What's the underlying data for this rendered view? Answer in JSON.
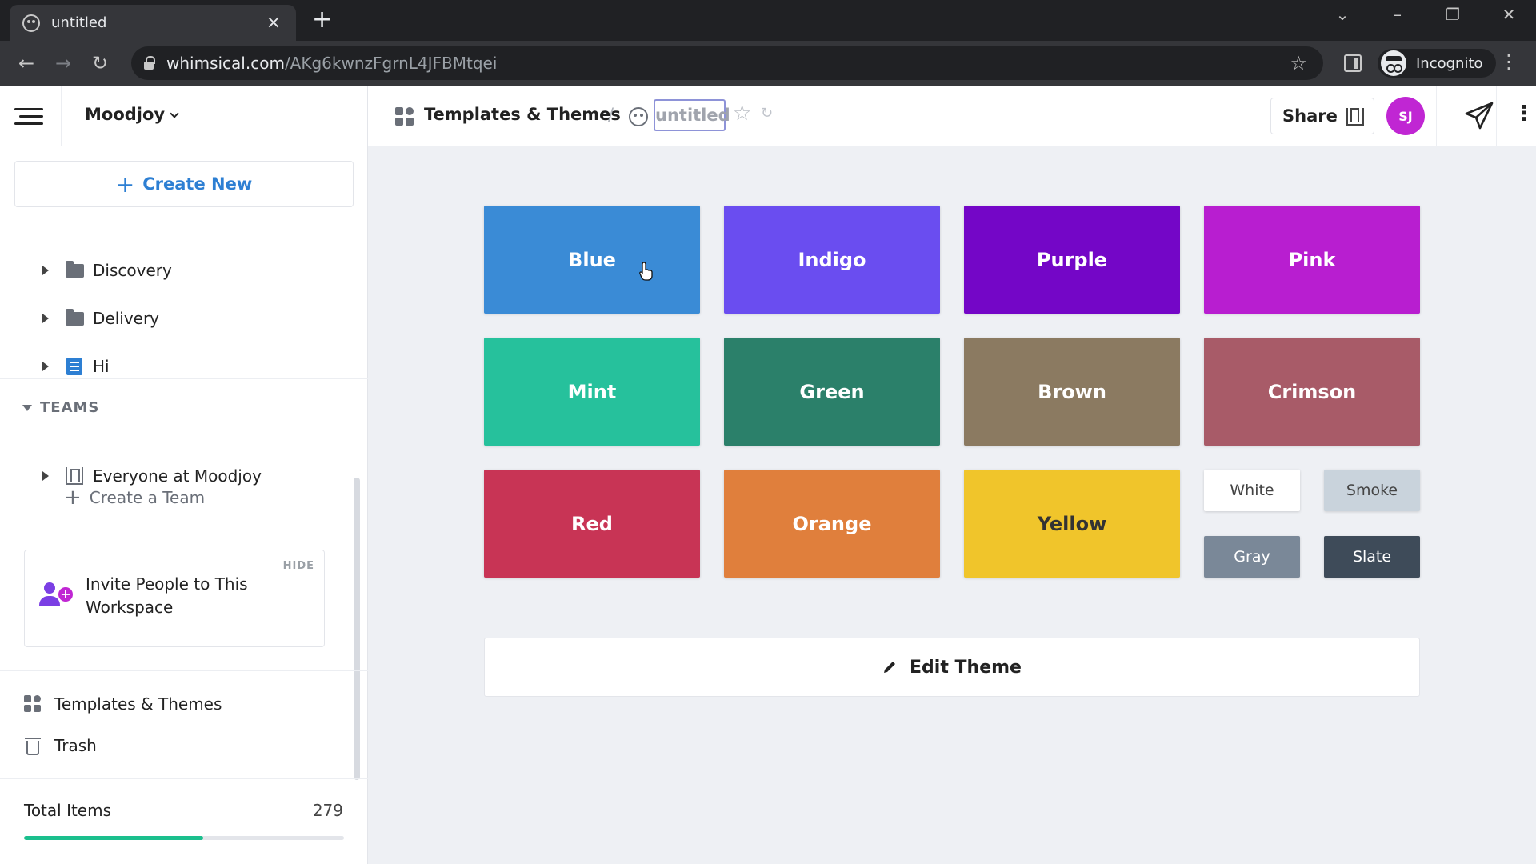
{
  "browser": {
    "tab_title": "untitled",
    "url_domain": "whimsical.com",
    "url_path": "/AKg6kwnzFgrnL4JFBMtqei",
    "profile_label": "Incognito"
  },
  "sidebar": {
    "workspace": "Moodjoy",
    "create_new": "Create New",
    "items": [
      {
        "label": "Discovery",
        "icon": "folder-icon"
      },
      {
        "label": "Delivery",
        "icon": "folder-icon"
      },
      {
        "label": "Hi",
        "icon": "document-icon"
      }
    ],
    "teams_heading": "TEAMS",
    "team": "Everyone at Moodjoy",
    "create_team": "Create a Team",
    "invite": {
      "hide": "HIDE",
      "text": "Invite People to This Workspace"
    },
    "templates": "Templates & Themes",
    "trash": "Trash",
    "total_label": "Total Items",
    "total_count": "279",
    "storage_progress": 0.56
  },
  "header": {
    "breadcrumb_parent": "Templates & Themes",
    "breadcrumb_separator": "/",
    "board_title": "untitled",
    "share_label": "Share",
    "avatar_initials": "SJ"
  },
  "colors": {
    "accent": "#2d7fd3",
    "avatar": "#c026d3",
    "progress": "#1bbf8d"
  },
  "swatches": [
    {
      "name": "Blue",
      "color": "#3a8bd6",
      "text": "#ffffff"
    },
    {
      "name": "Indigo",
      "color": "#6a4df0",
      "text": "#ffffff"
    },
    {
      "name": "Purple",
      "color": "#7406c7",
      "text": "#ffffff"
    },
    {
      "name": "Pink",
      "color": "#b81ed0",
      "text": "#ffffff"
    },
    {
      "name": "Mint",
      "color": "#26c19c",
      "text": "#ffffff"
    },
    {
      "name": "Green",
      "color": "#2b806a",
      "text": "#ffffff"
    },
    {
      "name": "Brown",
      "color": "#8b7a61",
      "text": "#ffffff"
    },
    {
      "name": "Crimson",
      "color": "#a85b68",
      "text": "#ffffff"
    },
    {
      "name": "Red",
      "color": "#c83455",
      "text": "#ffffff"
    },
    {
      "name": "Orange",
      "color": "#e07f3c",
      "text": "#ffffff"
    },
    {
      "name": "Yellow",
      "color": "#f0c52b",
      "text": "#333333"
    },
    {
      "name": "White",
      "color": "#ffffff",
      "text": "#444444"
    },
    {
      "name": "Smoke",
      "color": "#c9d3dc",
      "text": "#444444"
    },
    {
      "name": "Gray",
      "color": "#7a8898",
      "text": "#ffffff"
    },
    {
      "name": "Slate",
      "color": "#3e4b59",
      "text": "#ffffff"
    }
  ],
  "edit_theme": "Edit Theme"
}
